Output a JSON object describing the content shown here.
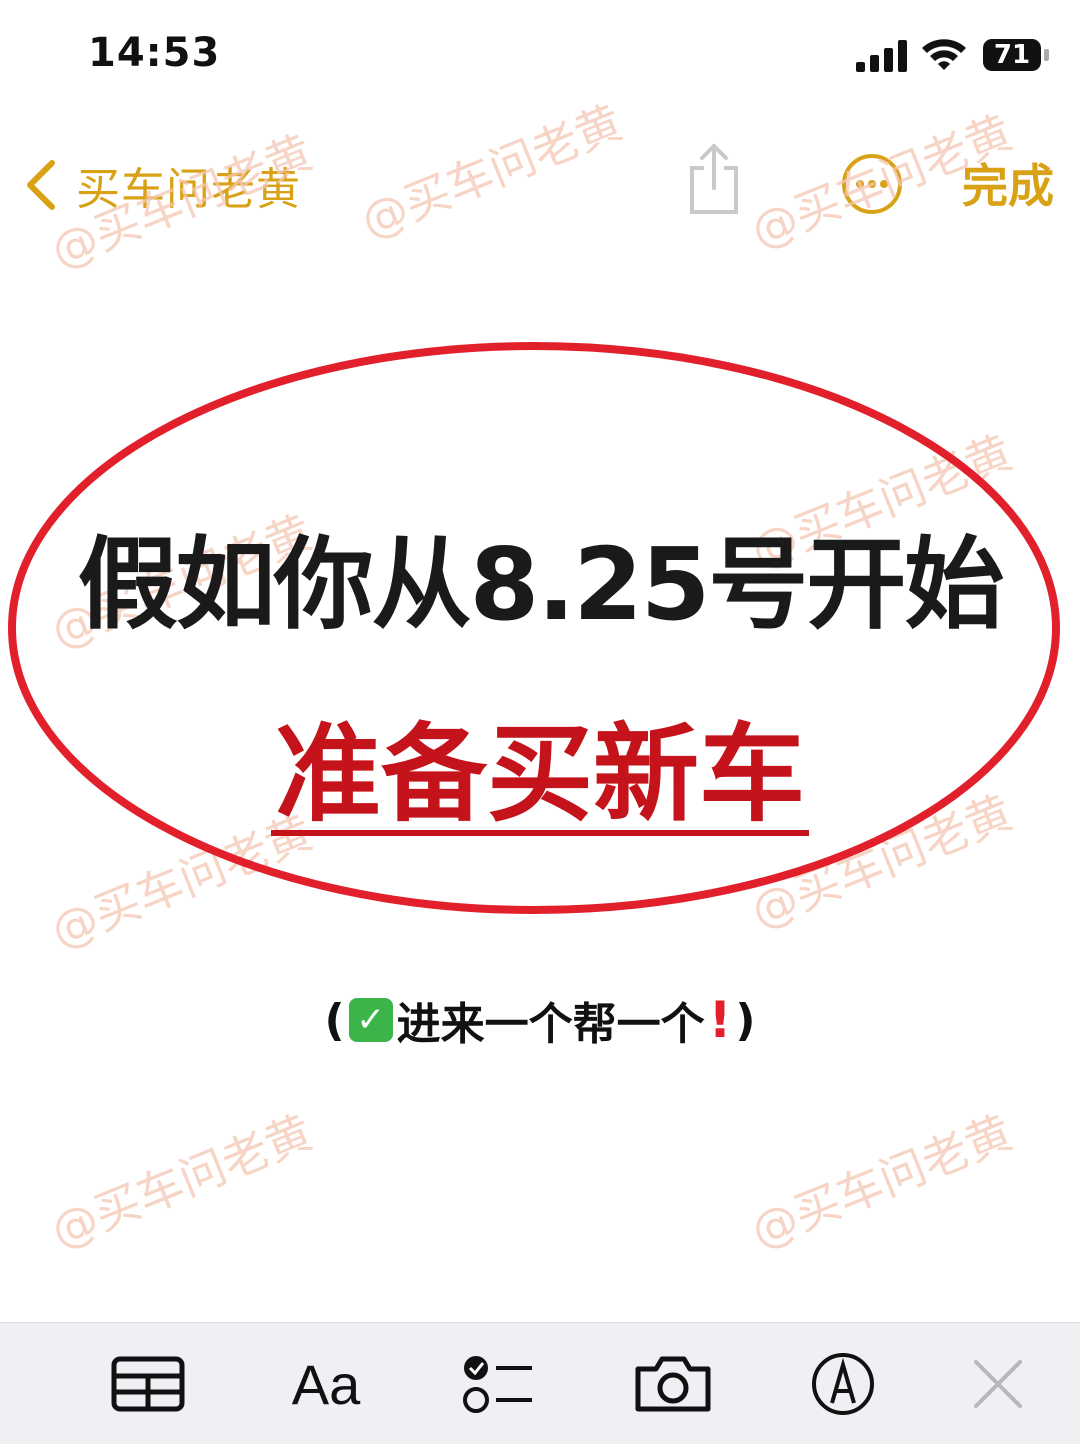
{
  "status_bar": {
    "time": "14:53",
    "battery": "71"
  },
  "nav": {
    "back_label": "买车问老黄",
    "done_label": "完成",
    "accent_color": "#d9a216"
  },
  "note": {
    "headline": "假如你从8.25号开始",
    "subheadline": "准备买新车",
    "tagline_prefix": "(",
    "tagline_text": "进来一个帮一个",
    "tagline_suffix": ")",
    "highlight_color": "#c4131b"
  },
  "watermark": {
    "text": "@买车问老黄"
  },
  "toolbar": {
    "format_label": "Aa"
  },
  "icons": [
    "chevron-left-icon",
    "share-icon",
    "more-icon",
    "table-icon",
    "checklist-icon",
    "camera-icon",
    "markup-icon",
    "close-icon",
    "checkmark-emoji-icon",
    "exclamation-emoji-icon",
    "signal-icon",
    "wifi-icon",
    "battery-icon"
  ]
}
